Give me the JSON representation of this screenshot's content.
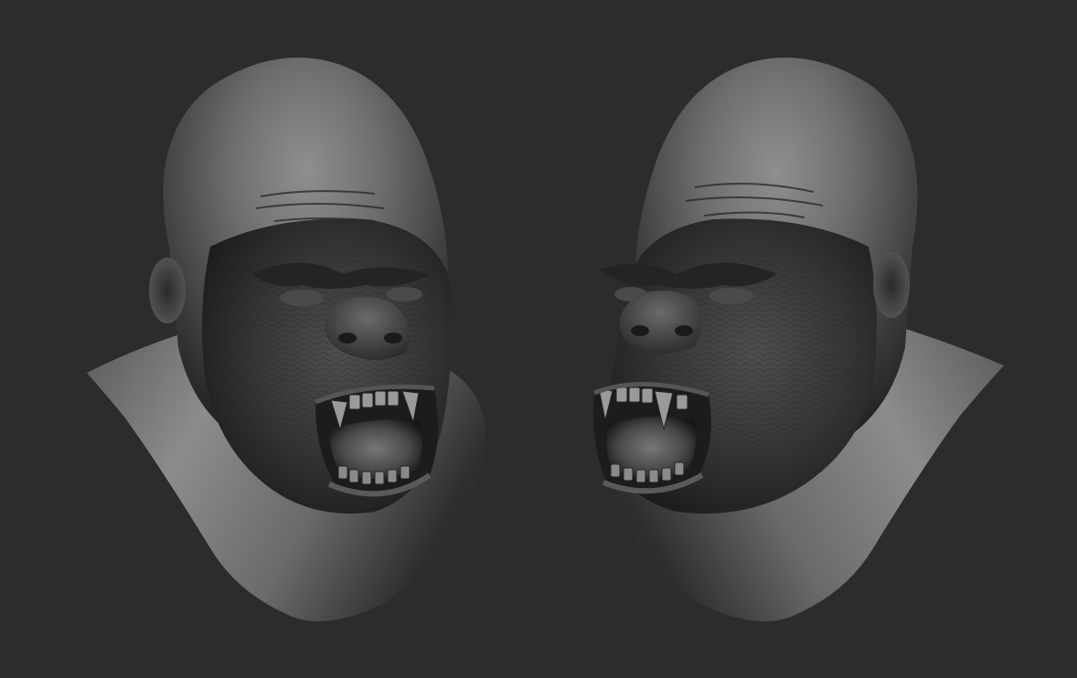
{
  "scene": {
    "background_color": "#2c2c2c",
    "material_color": "#8a8a8a",
    "subject": "gorilla-head-sculpt",
    "views": [
      {
        "name": "front-three-quarter-left"
      },
      {
        "name": "front-three-quarter-right"
      }
    ]
  }
}
